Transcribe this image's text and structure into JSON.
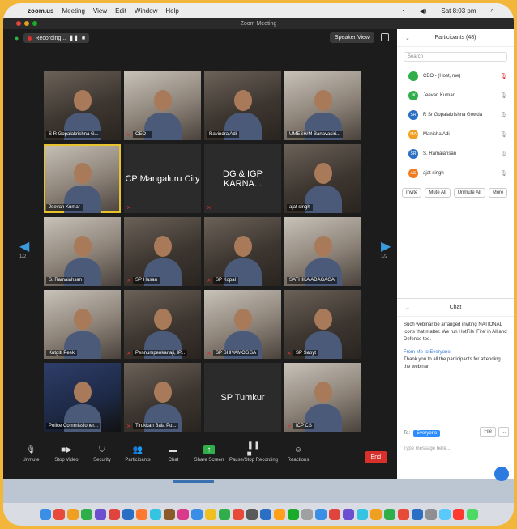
{
  "menubar": {
    "apple": "",
    "app": "zoom.us",
    "items": [
      "Meeting",
      "View",
      "Edit",
      "Window",
      "Help"
    ],
    "right_time": "Sat 8:03 pm"
  },
  "window": {
    "title": "Zoom Meeting"
  },
  "meeting": {
    "recording_label": "Recording...",
    "speaker_view": "Speaker View",
    "page_left": "1/2",
    "page_right": "1/2"
  },
  "tiles": [
    {
      "name": "S R Gopalakrishna G...",
      "style": "video",
      "muted": false,
      "active": false
    },
    {
      "name": "CEO -",
      "style": "video light",
      "muted": true,
      "active": false
    },
    {
      "name": "Ravindra Adi",
      "style": "video",
      "muted": false,
      "active": false
    },
    {
      "name": "UMESH/M Banavasiri...",
      "style": "video light",
      "muted": false,
      "active": false
    },
    {
      "name": "Jeevan Kumar",
      "style": "video light",
      "muted": false,
      "active": true
    },
    {
      "name": "",
      "style": "blank",
      "label": "CP Mangaluru City",
      "muted": true,
      "active": false
    },
    {
      "name": "",
      "style": "blank",
      "label": "DG & IGP KARNA...",
      "muted": true,
      "active": false
    },
    {
      "name": "ajat singh",
      "style": "video",
      "muted": false,
      "active": false
    },
    {
      "name": "S. Ramaiahsan",
      "style": "video light",
      "muted": false,
      "active": false
    },
    {
      "name": "SP Hasan",
      "style": "video",
      "muted": true,
      "active": false
    },
    {
      "name": "SP Kopal",
      "style": "video",
      "muted": true,
      "active": false
    },
    {
      "name": "SATHIKA ADAGAGA",
      "style": "video light",
      "muted": false,
      "active": false
    },
    {
      "name": "Kutgiti Peek",
      "style": "video light",
      "muted": false,
      "active": false
    },
    {
      "name": "Pennumpenkariaji, IP...",
      "style": "video",
      "muted": true,
      "active": false
    },
    {
      "name": "SP SHIVAMOGGA",
      "style": "video light",
      "muted": true,
      "active": false
    },
    {
      "name": "SP Sabyt",
      "style": "video",
      "muted": true,
      "active": false
    },
    {
      "name": "Police Commissioner...",
      "style": "video blue",
      "muted": false,
      "active": false
    },
    {
      "name": "Tirukkan Bala Pu...",
      "style": "video",
      "muted": true,
      "active": false
    },
    {
      "name": "",
      "style": "blank",
      "label": "SP Tumkur",
      "muted": false,
      "active": false
    },
    {
      "name": "ICP CS",
      "style": "video light",
      "muted": true,
      "active": false
    }
  ],
  "toolbar": {
    "unmute": "Unmute",
    "stop_video": "Stop Video",
    "security": "Security",
    "participants": "Participants",
    "chat": "Chat",
    "share_screen": "Share Screen",
    "pause_recording": "Pause/Stop Recording",
    "reactions": "Reactions",
    "end": "End"
  },
  "participants_panel": {
    "title": "Participants (48)",
    "search_placeholder": "Search",
    "rows": [
      {
        "initial": "",
        "name": "CEO - (Host, me)",
        "color": "#2fae4a",
        "mic_muted": true
      },
      {
        "initial": "JK",
        "name": "Jeevan Kumar",
        "color": "#2fae4a",
        "mic_muted": false
      },
      {
        "initial": "SR",
        "name": "R Sr Gopalakrishna Gowda",
        "color": "#2b6fc4",
        "mic_muted": false
      },
      {
        "initial": "MA",
        "name": "Manisha Adi",
        "color": "#f0a020",
        "mic_muted": false
      },
      {
        "initial": "SR",
        "name": "S. Ramaiahsan",
        "color": "#2b6fc4",
        "mic_muted": false
      },
      {
        "initial": "AS",
        "name": "ajat singh",
        "color": "#f07a20",
        "mic_muted": false
      }
    ],
    "buttons": [
      "Invite",
      "Mute All",
      "Unmute All",
      "More"
    ]
  },
  "chat_panel": {
    "title": "Chat",
    "message1": "Such webinar be arranged inviting NATIONAL icons that matter. We run HotFile 'Fire' in All and Defence too.",
    "from_line": "From Me to Everyone:",
    "message2": "Thank you to all the participants for attending the webinar.",
    "to_label": "To:",
    "to_value": "Everyone",
    "file_label": "File",
    "more_label": "...",
    "input_placeholder": "Type message here..."
  }
}
